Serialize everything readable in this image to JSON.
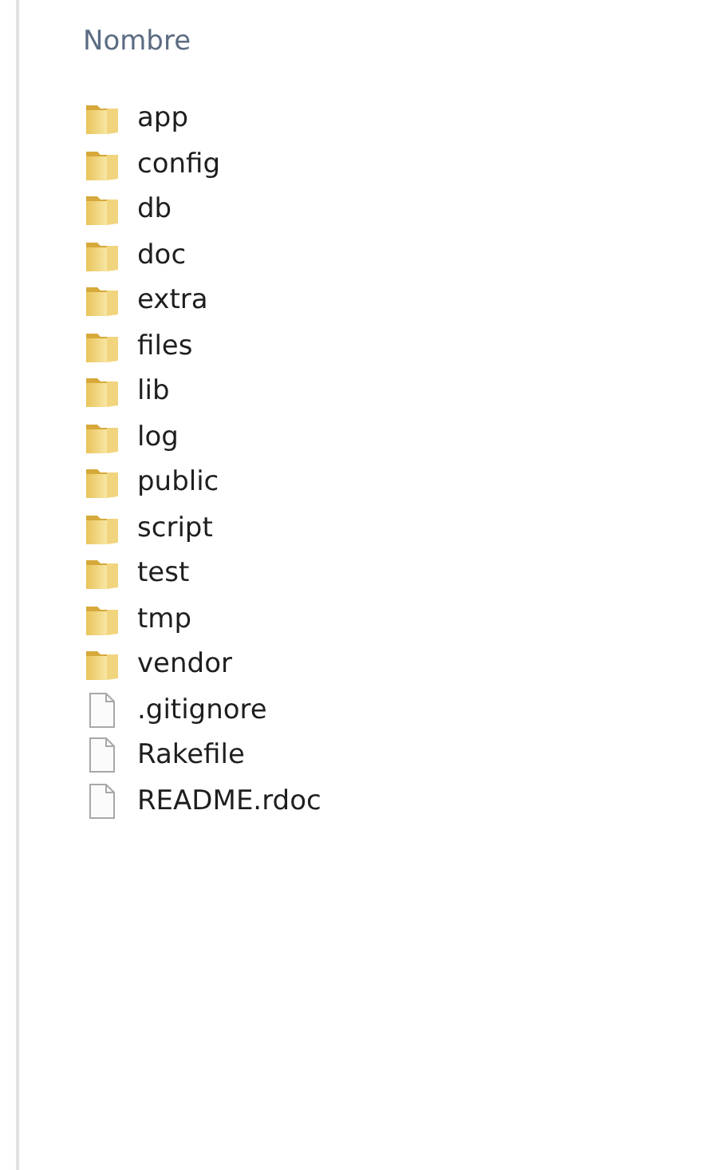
{
  "header": {
    "column_1": "Nombre"
  },
  "items": [
    {
      "kind": "folder",
      "name": "app"
    },
    {
      "kind": "folder",
      "name": "config"
    },
    {
      "kind": "folder",
      "name": "db"
    },
    {
      "kind": "folder",
      "name": "doc"
    },
    {
      "kind": "folder",
      "name": "extra"
    },
    {
      "kind": "folder",
      "name": "files"
    },
    {
      "kind": "folder",
      "name": "lib"
    },
    {
      "kind": "folder",
      "name": "log"
    },
    {
      "kind": "folder",
      "name": "public"
    },
    {
      "kind": "folder",
      "name": "script"
    },
    {
      "kind": "folder",
      "name": "test"
    },
    {
      "kind": "folder",
      "name": "tmp"
    },
    {
      "kind": "folder",
      "name": "vendor"
    },
    {
      "kind": "file",
      "name": ".gitignore"
    },
    {
      "kind": "file",
      "name": "Rakefile"
    },
    {
      "kind": "file",
      "name": "README.rdoc"
    }
  ]
}
